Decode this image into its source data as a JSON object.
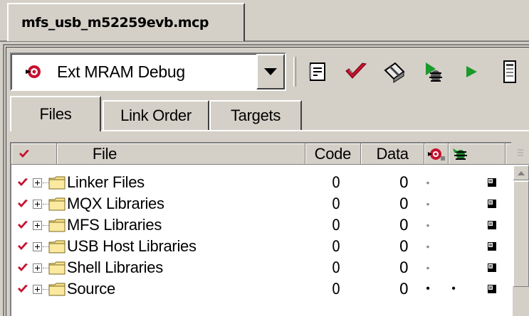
{
  "document_tab": {
    "label": "mfs_usb_m52259evb.mcp"
  },
  "target_selector": {
    "value": "Ext MRAM Debug",
    "icon": "debug-target-icon"
  },
  "toolbar": {
    "buttons": [
      {
        "name": "settings-icon"
      },
      {
        "name": "synchronize-check-icon"
      },
      {
        "name": "make-icon"
      },
      {
        "name": "debug-icon"
      },
      {
        "name": "run-icon"
      },
      {
        "name": "project-inspector-icon"
      }
    ]
  },
  "view_tabs": [
    {
      "label": "Files",
      "active": true
    },
    {
      "label": "Link Order",
      "active": false
    },
    {
      "label": "Targets",
      "active": false
    }
  ],
  "table": {
    "headers": {
      "file": "File",
      "code": "Code",
      "data": "Data"
    },
    "rows": [
      {
        "name": "Linker Files",
        "code": "0",
        "data": "0",
        "debug": "•",
        "debug_style": "gray",
        "bug": ""
      },
      {
        "name": "MQX Libraries",
        "code": "0",
        "data": "0",
        "debug": "•",
        "debug_style": "gray",
        "bug": ""
      },
      {
        "name": "MFS Libraries",
        "code": "0",
        "data": "0",
        "debug": "•",
        "debug_style": "gray",
        "bug": ""
      },
      {
        "name": "USB Host Libraries",
        "code": "0",
        "data": "0",
        "debug": "•",
        "debug_style": "gray",
        "bug": ""
      },
      {
        "name": "Shell Libraries",
        "code": "0",
        "data": "0",
        "debug": "•",
        "debug_style": "gray",
        "bug": ""
      },
      {
        "name": "Source",
        "code": "0",
        "data": "0",
        "debug": "•",
        "debug_style": "black",
        "bug": "•"
      }
    ]
  },
  "colors": {
    "window_bg": "#d4d0c8",
    "check_red": "#c8102e",
    "folder_yellow": "#f7e08a"
  }
}
